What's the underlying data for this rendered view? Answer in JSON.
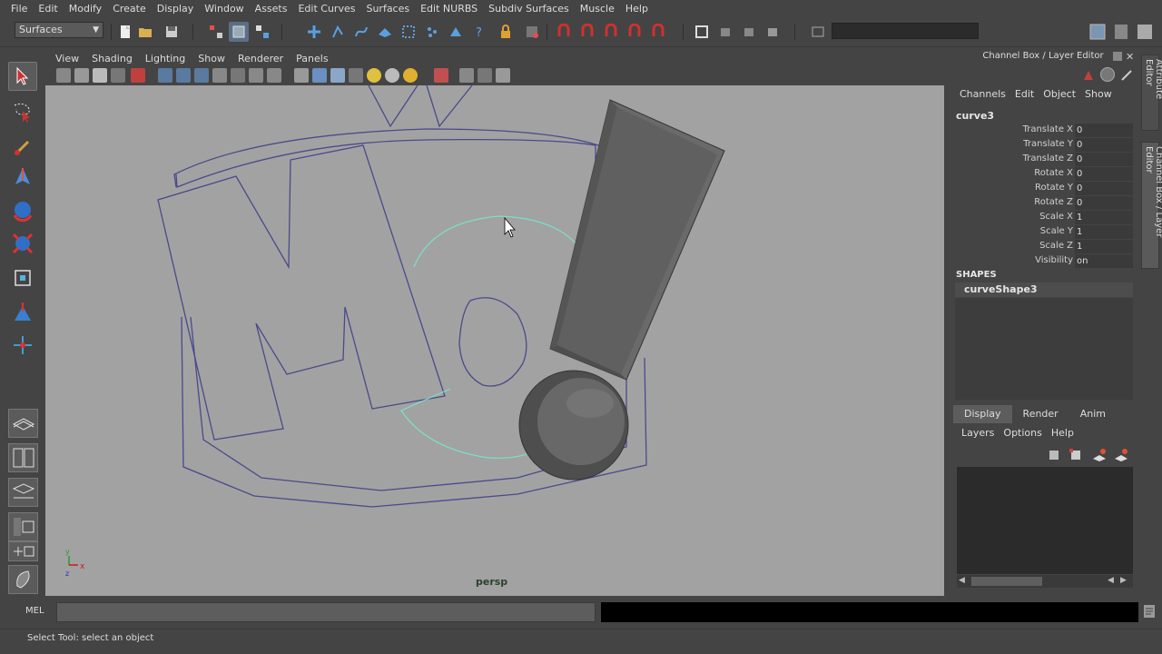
{
  "menubar": {
    "items": [
      "File",
      "Edit",
      "Modify",
      "Create",
      "Display",
      "Window",
      "Assets",
      "Edit Curves",
      "Surfaces",
      "Edit NURBS",
      "Subdiv Surfaces",
      "Muscle",
      "Help"
    ]
  },
  "statusline": {
    "mode": "Surfaces"
  },
  "viewport": {
    "menu": [
      "View",
      "Shading",
      "Lighting",
      "Show",
      "Renderer",
      "Panels"
    ],
    "camera": "persp",
    "colors": {
      "background": "#a2a2a2",
      "curve": "#4a4a8c",
      "selected_curve": "#7ce0c8",
      "geometry": "#5c5c5c"
    }
  },
  "channelbox": {
    "title": "Channel Box / Layer Editor",
    "menu": [
      "Channels",
      "Edit",
      "Object",
      "Show"
    ],
    "object": "curve3",
    "attributes": [
      {
        "name": "Translate X",
        "value": "0"
      },
      {
        "name": "Translate Y",
        "value": "0"
      },
      {
        "name": "Translate Z",
        "value": "0"
      },
      {
        "name": "Rotate X",
        "value": "0"
      },
      {
        "name": "Rotate Y",
        "value": "0"
      },
      {
        "name": "Rotate Z",
        "value": "0"
      },
      {
        "name": "Scale X",
        "value": "1"
      },
      {
        "name": "Scale Y",
        "value": "1"
      },
      {
        "name": "Scale Z",
        "value": "1"
      },
      {
        "name": "Visibility",
        "value": "on"
      }
    ],
    "shapes_header": "SHAPES",
    "shape": "curveShape3"
  },
  "layer_editor": {
    "tabs": [
      "Display",
      "Render",
      "Anim"
    ],
    "active_tab": "Display",
    "menu": [
      "Layers",
      "Options",
      "Help"
    ]
  },
  "sidetabs": {
    "attribute_editor": "Attribute Editor",
    "channel_box": "Channel Box / Layer Editor"
  },
  "commandline": {
    "label": "MEL"
  },
  "helpline": {
    "text": "Select Tool: select an object"
  }
}
